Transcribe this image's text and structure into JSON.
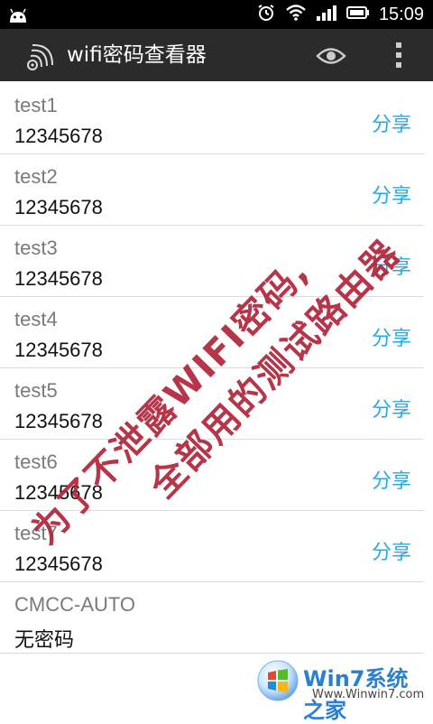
{
  "status_bar": {
    "time": "15:09",
    "icons": [
      "android-icon",
      "alarm-icon",
      "wifi-icon",
      "signal-icon",
      "battery-icon"
    ]
  },
  "action_bar": {
    "title": "wifi密码查看器",
    "icons": [
      "wifi-app-icon",
      "eye-icon",
      "overflow-menu-icon"
    ]
  },
  "networks": [
    {
      "name": "test1",
      "password": "12345678",
      "share_label": "分享"
    },
    {
      "name": "test2",
      "password": "12345678",
      "share_label": "分享"
    },
    {
      "name": "test3",
      "password": "12345678",
      "share_label": "分享"
    },
    {
      "name": "test4",
      "password": "12345678",
      "share_label": "分享"
    },
    {
      "name": "test5",
      "password": "12345678",
      "share_label": "分享"
    },
    {
      "name": "test6",
      "password": "12345678",
      "share_label": "分享"
    },
    {
      "name": "test7",
      "password": "12345678",
      "share_label": "分享"
    },
    {
      "name": "CMCC-AUTO",
      "password": "无密码",
      "share_label": ""
    }
  ],
  "watermark": {
    "line1": "为了不泄露WIFI密码,",
    "line2": "全部用的测试路由器"
  },
  "logo": {
    "brand": "Win7系统之家",
    "url": "Www.Winwin7.com"
  },
  "colors": {
    "accent": "#2aa9e0",
    "action_bar": "#2b2b2b",
    "watermark": "#b0243a"
  }
}
